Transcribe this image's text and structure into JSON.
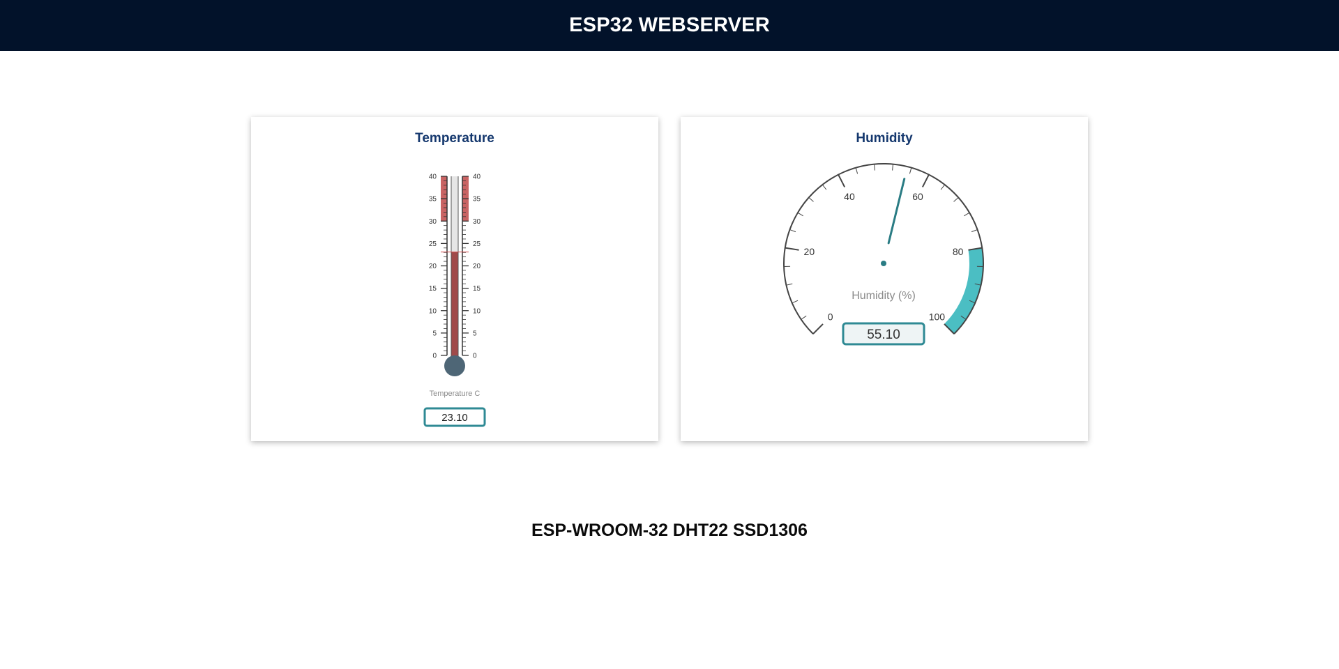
{
  "header": {
    "title": "ESP32 WEBSERVER"
  },
  "temperature": {
    "title": "Temperature",
    "unit_label": "Temperature C",
    "value": 23.1,
    "value_text": "23.10",
    "min": 0,
    "max": 40,
    "major_ticks": [
      "0",
      "5",
      "10",
      "15",
      "20",
      "25",
      "30",
      "35",
      "40"
    ],
    "highlight_range": [
      30,
      40
    ],
    "colors": {
      "fill": "#a04a4a",
      "highlight": "#c96464",
      "bulb": "#4e6676",
      "box_border": "#2f8a94"
    }
  },
  "humidity": {
    "title": "Humidity",
    "unit_label": "Humidity (%)",
    "value": 55.1,
    "value_text": "55.10",
    "min": 0,
    "max": 100,
    "major_ticks": [
      "0",
      "20",
      "40",
      "60",
      "80",
      "100"
    ],
    "highlight_range": [
      80,
      100
    ],
    "colors": {
      "needle": "#2a7c84",
      "highlight": "#4bbec3",
      "box_border": "#2f8a94"
    }
  },
  "footer": {
    "text": "ESP-WROOM-32 DHT22 SSD1306"
  }
}
